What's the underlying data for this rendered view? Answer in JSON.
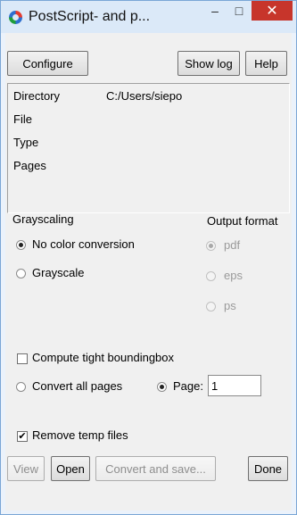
{
  "window": {
    "title": "PostScript- and p..."
  },
  "titlebar_buttons": {
    "minimize": "–",
    "maximize": "□",
    "close": "✕"
  },
  "toolbar": {
    "configure": "Configure",
    "show_log": "Show log",
    "help": "Help"
  },
  "info": {
    "directory_label": "Directory",
    "directory_value": "C:/Users/siepo",
    "file_label": "File",
    "type_label": "Type",
    "pages_label": "Pages"
  },
  "grayscaling": {
    "heading": "Grayscaling",
    "options": [
      "No color conversion",
      "Grayscale"
    ],
    "selected": "No color conversion"
  },
  "output_format": {
    "heading": "Output format",
    "options": [
      "pdf",
      "eps",
      "ps"
    ],
    "selected": "pdf",
    "enabled": false
  },
  "options": {
    "tight_bbox_label": "Compute tight boundingbox",
    "tight_bbox_checked": false,
    "convert_all_label": "Convert all pages",
    "page_label": "Page:",
    "page_value": "1",
    "page_selected": true,
    "remove_temp_label": "Remove temp files",
    "remove_temp_checked": true
  },
  "actions": {
    "view": "View",
    "open": "Open",
    "convert_save": "Convert and save...",
    "done": "Done"
  },
  "colors": {
    "close_button": "#c7352b",
    "window_frame": "#dbe9f8"
  }
}
